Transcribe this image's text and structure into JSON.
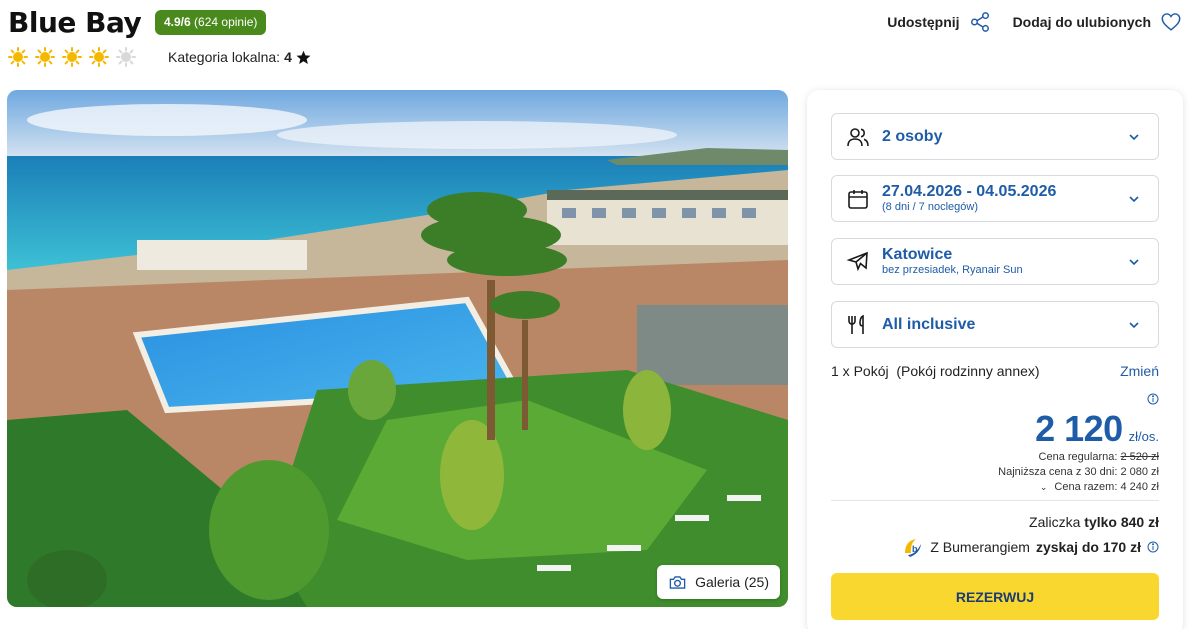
{
  "hotel": {
    "name": "Blue Bay",
    "rating": "4.9/6",
    "reviews": "(624 opinie)",
    "suns_filled": 4,
    "suns_total": 5,
    "category_label": "Kategoria lokalna:",
    "category_value": "4"
  },
  "actions": {
    "share_label": "Udostępnij",
    "favorite_label": "Dodaj do ulubionych"
  },
  "gallery": {
    "label": "Galeria (25)"
  },
  "booking": {
    "guests": "2 osoby",
    "dates": "27.04.2026 - 04.05.2026",
    "dates_sub": "(8 dni / 7 noclegów)",
    "departure": "Katowice",
    "departure_sub": "bez przesiadek, Ryanair Sun",
    "board": "All inclusive",
    "room": "1 x Pokój",
    "room_type": "(Pokój rodzinny annex)",
    "change_label": "Zmień",
    "price": "2 120",
    "price_unit": "zł/os.",
    "regular_label": "Cena regularna:",
    "regular_value": "2 520 zł",
    "lowest_label": "Najniższa cena z 30 dni:",
    "lowest_value": "2 080 zł",
    "total_label": "Cena razem:",
    "total_value": "4 240 zł",
    "deposit_label": "Zaliczka",
    "deposit_value": "tylko 840 zł",
    "bumerang_label": "Z Bumerangiem",
    "bumerang_value": "zyskaj do 170 zł",
    "reserve_label": "REZERWUJ"
  },
  "colors": {
    "brand_blue": "#1f5ca8",
    "rating_green": "#4a8a1c",
    "reserve_yellow": "#f9d72f",
    "sun_yellow": "#f5b800"
  }
}
